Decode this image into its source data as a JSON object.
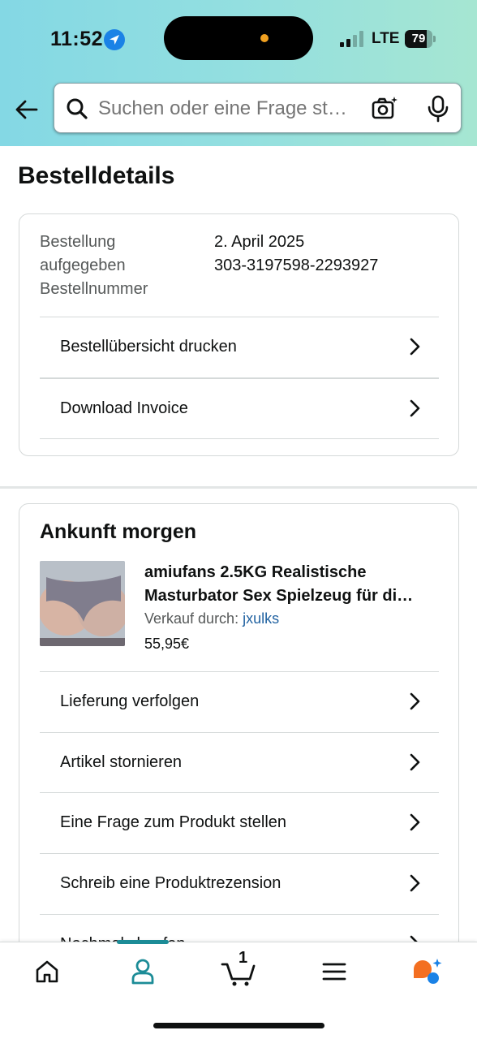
{
  "status_bar": {
    "time": "11:52",
    "network": "LTE",
    "battery_percent": "79",
    "battery_level": 0.79,
    "icons": [
      "location-arrow-icon",
      "signal-bars-icon",
      "battery-icon"
    ]
  },
  "search": {
    "placeholder": "Suchen oder eine Frage st…",
    "icons": [
      "back-arrow-icon",
      "search-icon",
      "camera-icon",
      "microphone-icon"
    ]
  },
  "page": {
    "title": "Bestelldetails"
  },
  "order_details": {
    "labels": [
      "Bestellung",
      "aufgegeben",
      "Bestellnummer"
    ],
    "values": [
      "2. April 2025",
      "303-3197598-2293927"
    ],
    "actions": [
      {
        "label": "Bestellübersicht drucken"
      },
      {
        "label": "Download Invoice"
      }
    ]
  },
  "shipment": {
    "title": "Ankunft morgen",
    "product": {
      "name_line1": "amiufans 2.5KG Realistische",
      "name_line2": "Masturbator Sex Spielzeug für di…",
      "seller_prefix": "Verkauf durch:",
      "seller_name": "jxulks",
      "price": "55,95€"
    },
    "actions": [
      {
        "label": "Lieferung verfolgen"
      },
      {
        "label": "Artikel stornieren"
      },
      {
        "label": "Eine Frage zum Produkt stellen"
      },
      {
        "label": "Schreib eine Produktrezension"
      },
      {
        "label": "Nochmals kaufen"
      }
    ]
  },
  "bottom_nav": {
    "items": [
      "home-icon",
      "account-icon",
      "cart-icon",
      "menu-icon",
      "rufus-assistant-icon"
    ],
    "active": "account-icon",
    "cart_count": "1"
  },
  "colors": {
    "header_gradient_start": "#84d8e4",
    "header_gradient_end": "#a6e6d2",
    "link": "#2162a1",
    "active_nav": "#1c8c97",
    "assistant_orange": "#f36f21",
    "assistant_blue": "#1a82e6"
  }
}
